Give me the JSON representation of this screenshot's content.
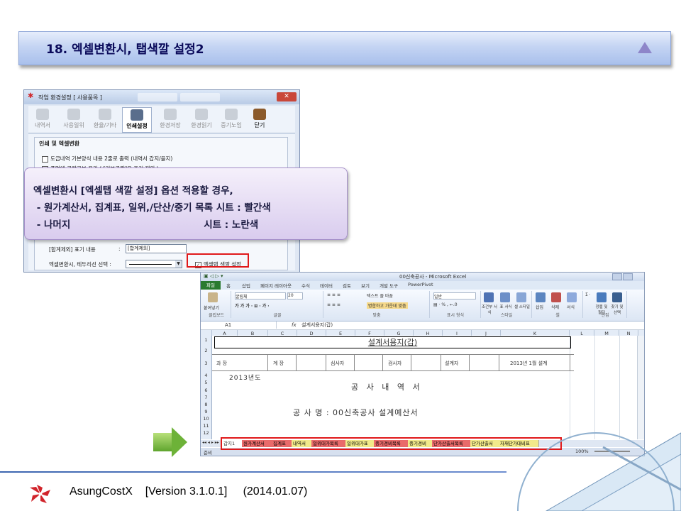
{
  "slide": {
    "title": "18. 엑셀변환시, 탭색깔 설정2"
  },
  "dialog": {
    "title": "작업 환경설정 [ 사용품목 ]",
    "toolbar": [
      {
        "label": "내역서"
      },
      {
        "label": "사용일위"
      },
      {
        "label": "환율/기타"
      },
      {
        "label": "인쇄설정"
      },
      {
        "label": "환경저장"
      },
      {
        "label": "환경읽기"
      },
      {
        "label": "중기노임"
      },
      {
        "label": "닫기"
      }
    ],
    "group_title": "인쇄 및 엑셀변환",
    "option1": "도급내역 기본양식 내용 2줄로 출력  (내역서 갑지/을지)",
    "option2": "품명에 공량구분 표기  ( [기본공량]은 표기 제외 )",
    "subtotal_label": "[합계제외] 표기 내용",
    "subtotal_colon": ":",
    "subtotal_value": "[합계제외]",
    "border_label": "엑셀변환시,  테두리선 선택 :",
    "tab_color_option": "엑셀탭 색깔 설정"
  },
  "callout": {
    "line1": "엑셀변환시 [엑셀탭 색깔 설정] 옵션 적용할 경우,",
    "line2": " - 원가계산서, 집계표, 일위,/단산/중기 목록 시트 : 빨간색",
    "line3": " - 나머지                                        시트 : 노란색"
  },
  "excel": {
    "window_title": "00신축공사 - Microsoft Excel",
    "ribbon_tabs": [
      "파일",
      "홈",
      "삽입",
      "페이지 레이아웃",
      "수식",
      "데이터",
      "검토",
      "보기",
      "개발 도구",
      "PowerPivot"
    ],
    "font_name": "굴림체",
    "font_size": "20",
    "wrap_text": "텍스트 줄 바꿈",
    "merge_center": "병합하고 가운데 맞춤",
    "number_format": "일반",
    "groups": [
      "클립보드",
      "글꼴",
      "맞춤",
      "표시 형식",
      "스타일",
      "셀",
      "편집"
    ],
    "ribbon_buttons": [
      "붙여넣기",
      "조건부 서식",
      "표 서식",
      "셀 스타일",
      "삽입",
      "삭제",
      "서식",
      "정렬 및 필터",
      "찾기 및 선택"
    ],
    "name_box": "A1",
    "fx": "fx",
    "formula": "설계서용지(갑)",
    "columns": [
      "A",
      "B",
      "C",
      "D",
      "E",
      "F",
      "G",
      "H",
      "I",
      "J",
      "K",
      "L",
      "M",
      "N"
    ],
    "rows": [
      "1",
      "2",
      "3",
      "4",
      "5",
      "6",
      "7",
      "8",
      "9",
      "10",
      "11",
      "12"
    ],
    "sheet_title": "설계서용지(갑)",
    "approval": [
      "과  장",
      "계  장",
      "심사자",
      "검사자",
      "설계자",
      "2013년  1월   설계"
    ],
    "year": "2013년도",
    "heading": "공 사 내 역 서",
    "project": "공 사 명 : 00신축공사 설계예산서",
    "sheet_tabs": [
      {
        "name": "갑지1",
        "color": "none"
      },
      {
        "name": "원가계산서",
        "color": "red"
      },
      {
        "name": "집계표",
        "color": "red"
      },
      {
        "name": "내역서",
        "color": "yellow"
      },
      {
        "name": "일위대가목록",
        "color": "red"
      },
      {
        "name": "일위대가표",
        "color": "yellow"
      },
      {
        "name": "중기경비목록",
        "color": "red"
      },
      {
        "name": "중기경비",
        "color": "yellow"
      },
      {
        "name": "단가산출서목록",
        "color": "red"
      },
      {
        "name": "단가산출서",
        "color": "yellow"
      },
      {
        "name": "자재단가대비표",
        "color": "yellow"
      }
    ],
    "status": "준비",
    "zoom": "100%"
  },
  "footer": {
    "text": "AsungCostX    [Version 3.1.0.1]     (2014.01.07)"
  },
  "colors": {
    "header_gradient": "#c4d4f3",
    "callout_bg": "#d9ccee",
    "highlight_red": "#e0191a",
    "tab_red": "#e96a6a",
    "tab_yellow": "#f2ea8a",
    "arrow_green": "#6db238"
  }
}
